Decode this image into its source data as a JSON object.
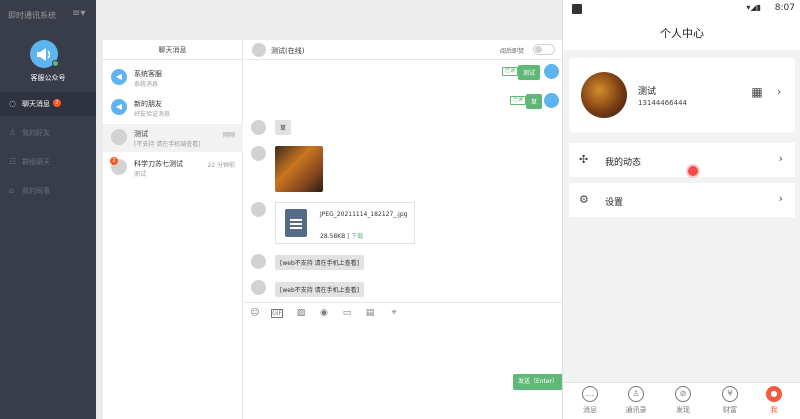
{
  "sidebar": {
    "brand": "即时通讯系统",
    "menu_icon": "≡▾",
    "account_name": "客服公众号",
    "nav": [
      {
        "label": "聊天消息",
        "badge": "2",
        "icon": "chat-icon"
      },
      {
        "label": "我的好友",
        "icon": "user-icon"
      },
      {
        "label": "群组聊天",
        "icon": "group-icon"
      },
      {
        "label": "我的同事",
        "icon": "colleague-icon"
      }
    ]
  },
  "conversations": {
    "header": "聊天消息",
    "items": [
      {
        "name": "系统客服",
        "sub": "系统消息",
        "time": ""
      },
      {
        "name": "新的朋友",
        "sub": "好友验证消息",
        "time": ""
      },
      {
        "name": "测试",
        "sub": "[不支持 请在手机端查看]",
        "time": "刚刚"
      },
      {
        "name": "科学刀苏七测试",
        "sub": "测试",
        "time": "22 分钟前",
        "badge": "2"
      }
    ]
  },
  "chat": {
    "title": "测试(在线)",
    "burn_label": "阅后即焚",
    "messages": [
      {
        "text": "测试",
        "read": "已读"
      },
      {
        "text": "草",
        "read": "已读"
      },
      {
        "text": "草"
      },
      {
        "text": "[web不支持 请在手机上查看]"
      },
      {
        "text": "[web不支持 请在手机上查看]"
      }
    ],
    "file": {
      "name": "JPEG_20211114_182127_.jpg",
      "size": "28.58KB",
      "sep": "|",
      "download": "下载"
    },
    "tools": [
      "smile-icon",
      "gif-icon",
      "image-icon",
      "audio-icon",
      "file-icon",
      "card-icon",
      "location-icon"
    ],
    "send_label": "发送（Enter）"
  },
  "phone": {
    "time": "8:07",
    "title": "个人中心",
    "name": "测试",
    "phone": "13144466444",
    "rows": [
      {
        "label": "我的动态",
        "icon": "pinwheel-icon"
      },
      {
        "label": "设置",
        "icon": "settings-icon"
      }
    ],
    "tabs": [
      {
        "label": "消息",
        "icon": "message-icon"
      },
      {
        "label": "通讯录",
        "icon": "contacts-icon"
      },
      {
        "label": "发现",
        "icon": "compass-icon"
      },
      {
        "label": "财富",
        "icon": "yen-icon"
      },
      {
        "label": "我",
        "icon": "me-icon",
        "active": true
      }
    ],
    "accent": "#f55a3c"
  }
}
